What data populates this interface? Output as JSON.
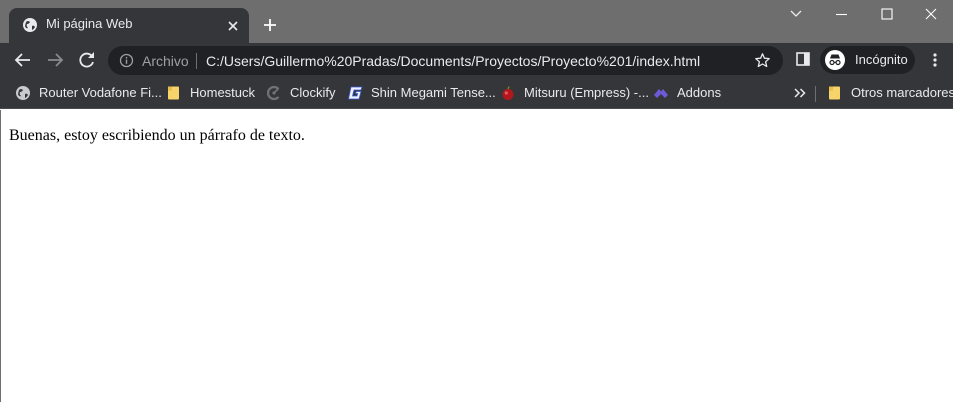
{
  "tab": {
    "title": "Mi página Web",
    "favicon": "globe-icon"
  },
  "window_controls": [
    "tab-search-icon",
    "minimize-icon",
    "maximize-icon",
    "close-icon"
  ],
  "toolbar": {
    "scheme_label": "Archivo",
    "url": "C:/Users/Guillermo%20Pradas/Documents/Proyectos/Proyecto%201/index.html",
    "incognito_label": "Incógnito"
  },
  "bookmarks": {
    "items": [
      {
        "label": "Router Vodafone Fi...",
        "icon": "globe-icon"
      },
      {
        "label": "Homestuck",
        "icon": "folder-icon"
      },
      {
        "label": "Clockify",
        "icon": "clockify-icon"
      },
      {
        "label": "Shin Megami Tense...",
        "icon": "g-logo-icon"
      },
      {
        "label": "Mitsuru (Empress) -...",
        "icon": "apple-icon"
      },
      {
        "label": "Addons",
        "icon": "addons-icon"
      }
    ],
    "other_label": "Otros marcadores"
  },
  "page": {
    "paragraph": "Buenas, estoy escribiendo un párrafo de texto."
  },
  "colors": {
    "titlebar": "#6e6e6e",
    "toolbar": "#35363a",
    "omnibox": "#202124",
    "text": "#e8eaed",
    "muted": "#9aa0a6"
  }
}
